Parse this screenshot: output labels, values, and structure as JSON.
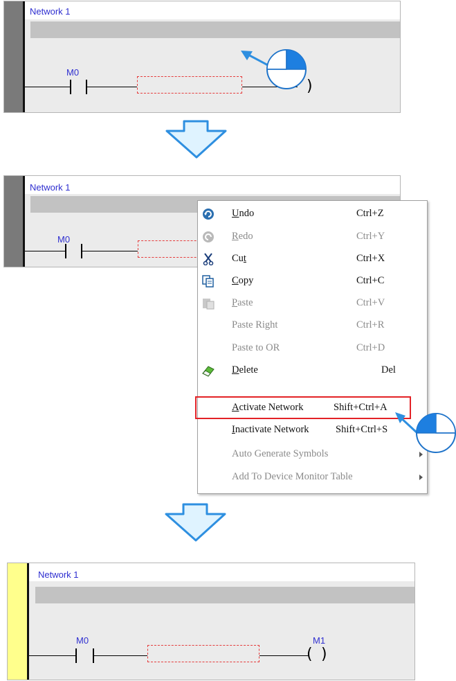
{
  "panels": [
    {
      "network_title": "Network 1",
      "contact_label": "M0",
      "coil_label": ""
    },
    {
      "network_title": "Network 1",
      "contact_label": "M0"
    },
    {
      "network_title": "Network 1",
      "contact_label": "M0",
      "coil_label": "M1"
    }
  ],
  "context_menu": {
    "items": [
      {
        "accel": "U",
        "rest": "ndo",
        "shortcut": "Ctrl+Z",
        "enabled": true,
        "icon": "undo-icon"
      },
      {
        "accel": "R",
        "rest": "edo",
        "shortcut": "Ctrl+Y",
        "enabled": false,
        "icon": "redo-icon"
      },
      {
        "pre": "Cu",
        "accel": "t",
        "rest": "",
        "shortcut": "Ctrl+X",
        "enabled": true,
        "icon": "scissors-icon"
      },
      {
        "accel": "C",
        "rest": "opy",
        "shortcut": "Ctrl+C",
        "enabled": true,
        "icon": "copy-icon"
      },
      {
        "accel": "P",
        "rest": "aste",
        "shortcut": "Ctrl+V",
        "enabled": false,
        "icon": "paste-icon"
      },
      {
        "label": "Paste Right",
        "shortcut": "Ctrl+R",
        "enabled": false
      },
      {
        "label": "Paste to OR",
        "shortcut": "Ctrl+D",
        "enabled": false
      },
      {
        "accel": "D",
        "rest": "elete",
        "shortcut": "Del",
        "enabled": true,
        "icon": "eraser-icon"
      },
      {
        "accel": "A",
        "rest": "ctivate Network",
        "shortcut": "Shift+Ctrl+A",
        "enabled": true,
        "highlighted": true
      },
      {
        "accel": "I",
        "rest": "nactivate Network",
        "shortcut": "Shift+Ctrl+S",
        "enabled": true
      },
      {
        "label": "Auto Generate Symbols",
        "shortcut": "",
        "enabled": false,
        "submenu": true
      },
      {
        "label": "Add To Device Monitor Table",
        "shortcut": "",
        "enabled": false,
        "submenu": true
      }
    ]
  },
  "colors": {
    "inactive_bar": "#7a7a7a",
    "active_bar": "#ffff8c",
    "highlight_border": "#e32226",
    "flow_arrow": "#2e8fe0",
    "network_title": "#2f2fd0"
  }
}
